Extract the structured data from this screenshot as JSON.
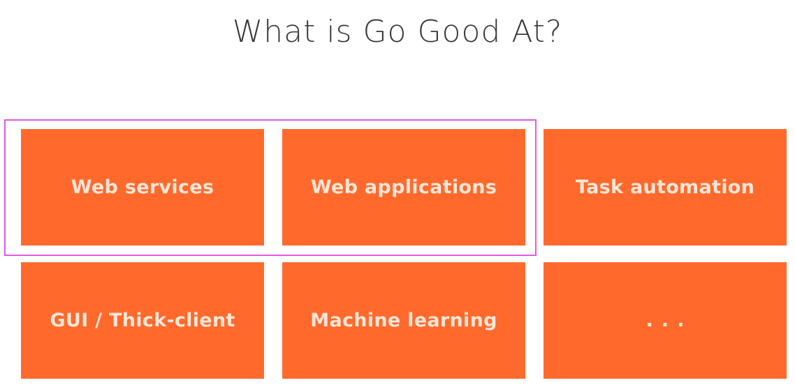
{
  "title": "What is Go Good At?",
  "tiles": [
    {
      "label": "Web services"
    },
    {
      "label": "Web applications"
    },
    {
      "label": "Task automation"
    },
    {
      "label": "GUI / Thick-client"
    },
    {
      "label": "Machine learning"
    },
    {
      "label": "..."
    }
  ],
  "colors": {
    "tile_background": "#ff6a2c",
    "tile_text": "#fbe6d8",
    "title_text": "#3a3a3a",
    "highlight_border": "#e25be0"
  }
}
